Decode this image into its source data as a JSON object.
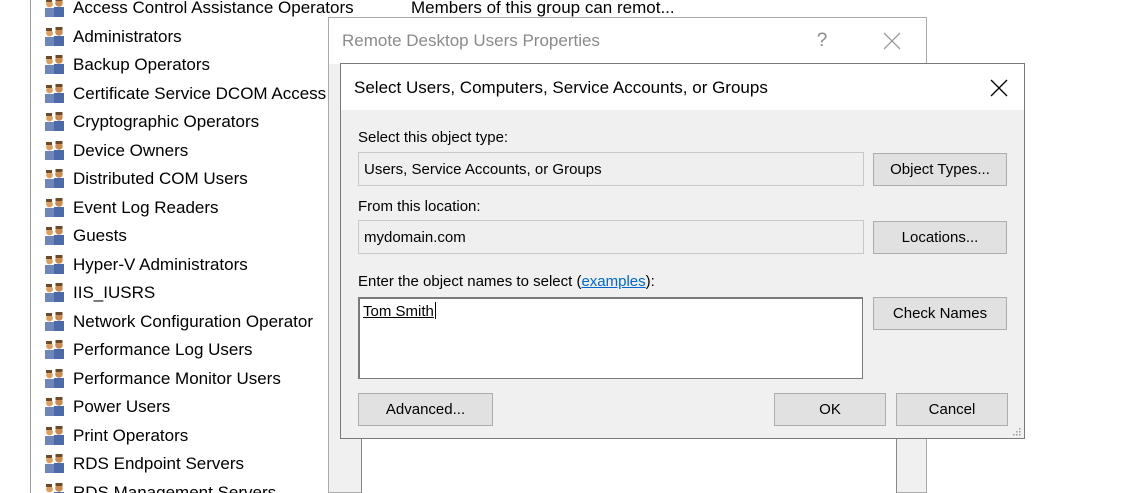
{
  "group_list": {
    "items": [
      "Access Control Assistance Operators",
      "Administrators",
      "Backup Operators",
      "Certificate Service DCOM Access",
      "Cryptographic Operators",
      "Device Owners",
      "Distributed COM Users",
      "Event Log Readers",
      "Guests",
      "Hyper-V Administrators",
      "IIS_IUSRS",
      "Network Configuration Operator",
      "Performance Log Users",
      "Performance Monitor Users",
      "Power Users",
      "Print Operators",
      "RDS Endpoint Servers",
      "RDS Management Servers"
    ],
    "first_description": "Members of this group can remot..."
  },
  "properties_window": {
    "title": "Remote Desktop Users Properties",
    "help_glyph": "?"
  },
  "select_dialog": {
    "title": "Select Users, Computers, Service Accounts, or Groups",
    "object_type_label": "Select this object type:",
    "object_type_value": "Users, Service Accounts, or Groups",
    "object_types_button": "Object Types...",
    "location_label": "From this location:",
    "location_value": "mydomain.com",
    "locations_button": "Locations...",
    "names_label_prefix": "Enter the object names to select (",
    "names_label_link": "examples",
    "names_label_suffix": "):",
    "names_value": "Tom Smith",
    "check_names_button": "Check Names",
    "advanced_button": "Advanced...",
    "ok_button": "OK",
    "cancel_button": "Cancel"
  },
  "colors": {
    "link": "#0066cc",
    "button_face": "#e1e1e1",
    "dialog_bg": "#f0f0f0"
  }
}
